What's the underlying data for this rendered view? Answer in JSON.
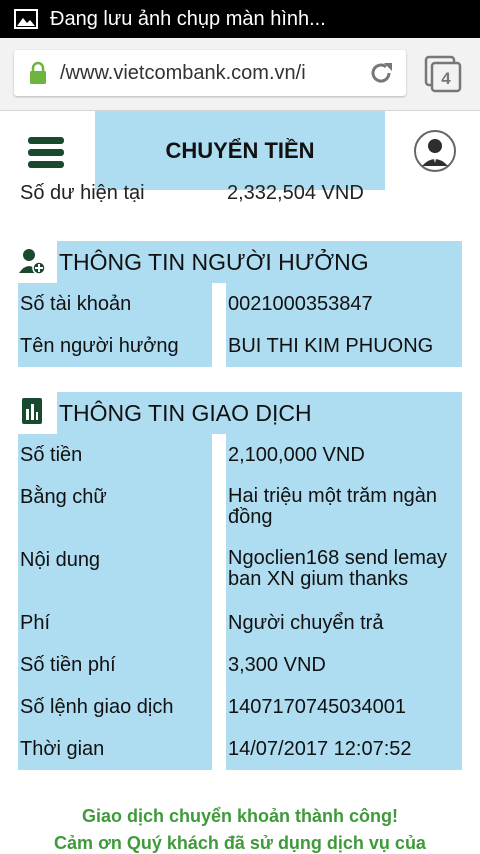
{
  "status_bar": {
    "notification": "Đang lưu ảnh chụp màn hình..."
  },
  "browser": {
    "url": "/www.vietcombank.com.vn/i",
    "tab_count": "4"
  },
  "header": {
    "title": "CHUYỂN TIỀN"
  },
  "balance": {
    "label": "Số dư hiện tại",
    "value": "2,332,504 VND"
  },
  "beneficiary": {
    "title": "THÔNG TIN NGƯỜI HƯỞNG",
    "rows": [
      {
        "label": "Số tài khoản",
        "value": "0021000353847"
      },
      {
        "label": "Tên người hưởng",
        "value": "BUI THI KIM PHUONG"
      }
    ]
  },
  "transaction": {
    "title": "THÔNG TIN GIAO DỊCH",
    "rows": [
      {
        "label": "Số tiền",
        "value": "2,100,000 VND"
      },
      {
        "label": "Bằng chữ",
        "value": "Hai triệu một trăm ngàn đồng"
      },
      {
        "label": "Nội dung",
        "value": "Ngoclien168 send lemay ban XN gium thanks"
      },
      {
        "label": "Phí",
        "value": "Người chuyển trả"
      },
      {
        "label": "Số tiền phí",
        "value": "3,300 VND"
      },
      {
        "label": "Số lệnh giao dịch",
        "value": "1407170745034001"
      },
      {
        "label": "Thời gian",
        "value": "14/07/2017 12:07:52"
      }
    ]
  },
  "message": {
    "line1": "Giao dịch chuyển khoản thành công!",
    "line2": "Cảm ơn Quý khách đã sử dụng dịch vụ của"
  },
  "icons": {
    "statusbar": "image-icon",
    "secure": "lock-icon",
    "reload": "reload-icon",
    "tabs": "tabs-icon",
    "menu": "hamburger-menu-icon",
    "profile": "user-avatar-icon",
    "beneficiary": "add-user-icon",
    "transaction": "receipt-icon"
  },
  "colors": {
    "highlight": "#aedcf1",
    "brand_green": "#1a4a2e",
    "success_green": "#3f9a3a"
  }
}
